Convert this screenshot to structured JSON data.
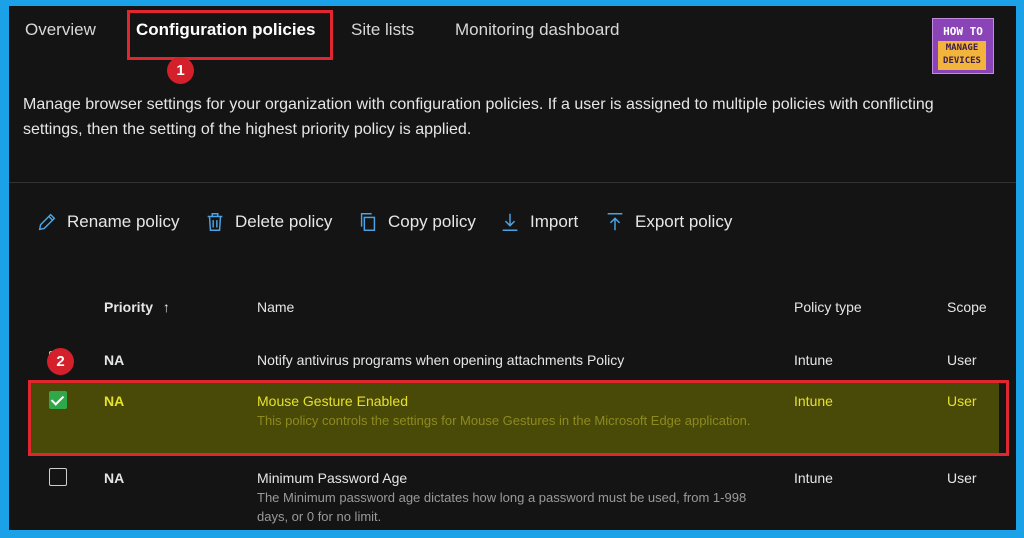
{
  "tabs": [
    {
      "label": "Overview",
      "active": false
    },
    {
      "label": "Configuration policies",
      "active": true
    },
    {
      "label": "Site lists",
      "active": false
    },
    {
      "label": "Monitoring dashboard",
      "active": false
    }
  ],
  "logo": {
    "line1": "HOW TO",
    "line2": "MANAGE",
    "line3": "DEVICES"
  },
  "annotations": {
    "badge1": "1",
    "badge2": "2"
  },
  "description": "Manage browser settings for your organization with configuration policies. If a user is assigned to multiple policies with conflicting settings, then the setting of the highest priority policy is applied.",
  "toolbar": {
    "rename": "Rename policy",
    "delete": "Delete policy",
    "copy": "Copy policy",
    "import": "Import",
    "export": "Export policy"
  },
  "table": {
    "headers": {
      "priority": "Priority",
      "priority_sort": "↑",
      "name": "Name",
      "policy_type": "Policy type",
      "scope": "Scope"
    },
    "rows": [
      {
        "priority": "NA",
        "name": "Notify antivirus programs when opening attachments Policy",
        "description": "",
        "policy_type": "Intune",
        "scope": "User",
        "checked": false
      },
      {
        "priority": "NA",
        "name": "Mouse Gesture Enabled",
        "description": "This policy controls the settings for Mouse Gestures in the Microsoft Edge application.",
        "policy_type": "Intune",
        "scope": "User",
        "checked": true
      },
      {
        "priority": "NA",
        "name": "Minimum Password Age",
        "description": "The Minimum password age dictates how long a password must be used, from 1-998 days, or 0 for no limit.",
        "policy_type": "Intune",
        "scope": "User",
        "checked": false
      }
    ]
  },
  "colors": {
    "accent": "#1aa1e8",
    "highlight": "#e4e22b",
    "annotation_red": "#e0262f",
    "checkbox_green": "#2fa84a"
  }
}
